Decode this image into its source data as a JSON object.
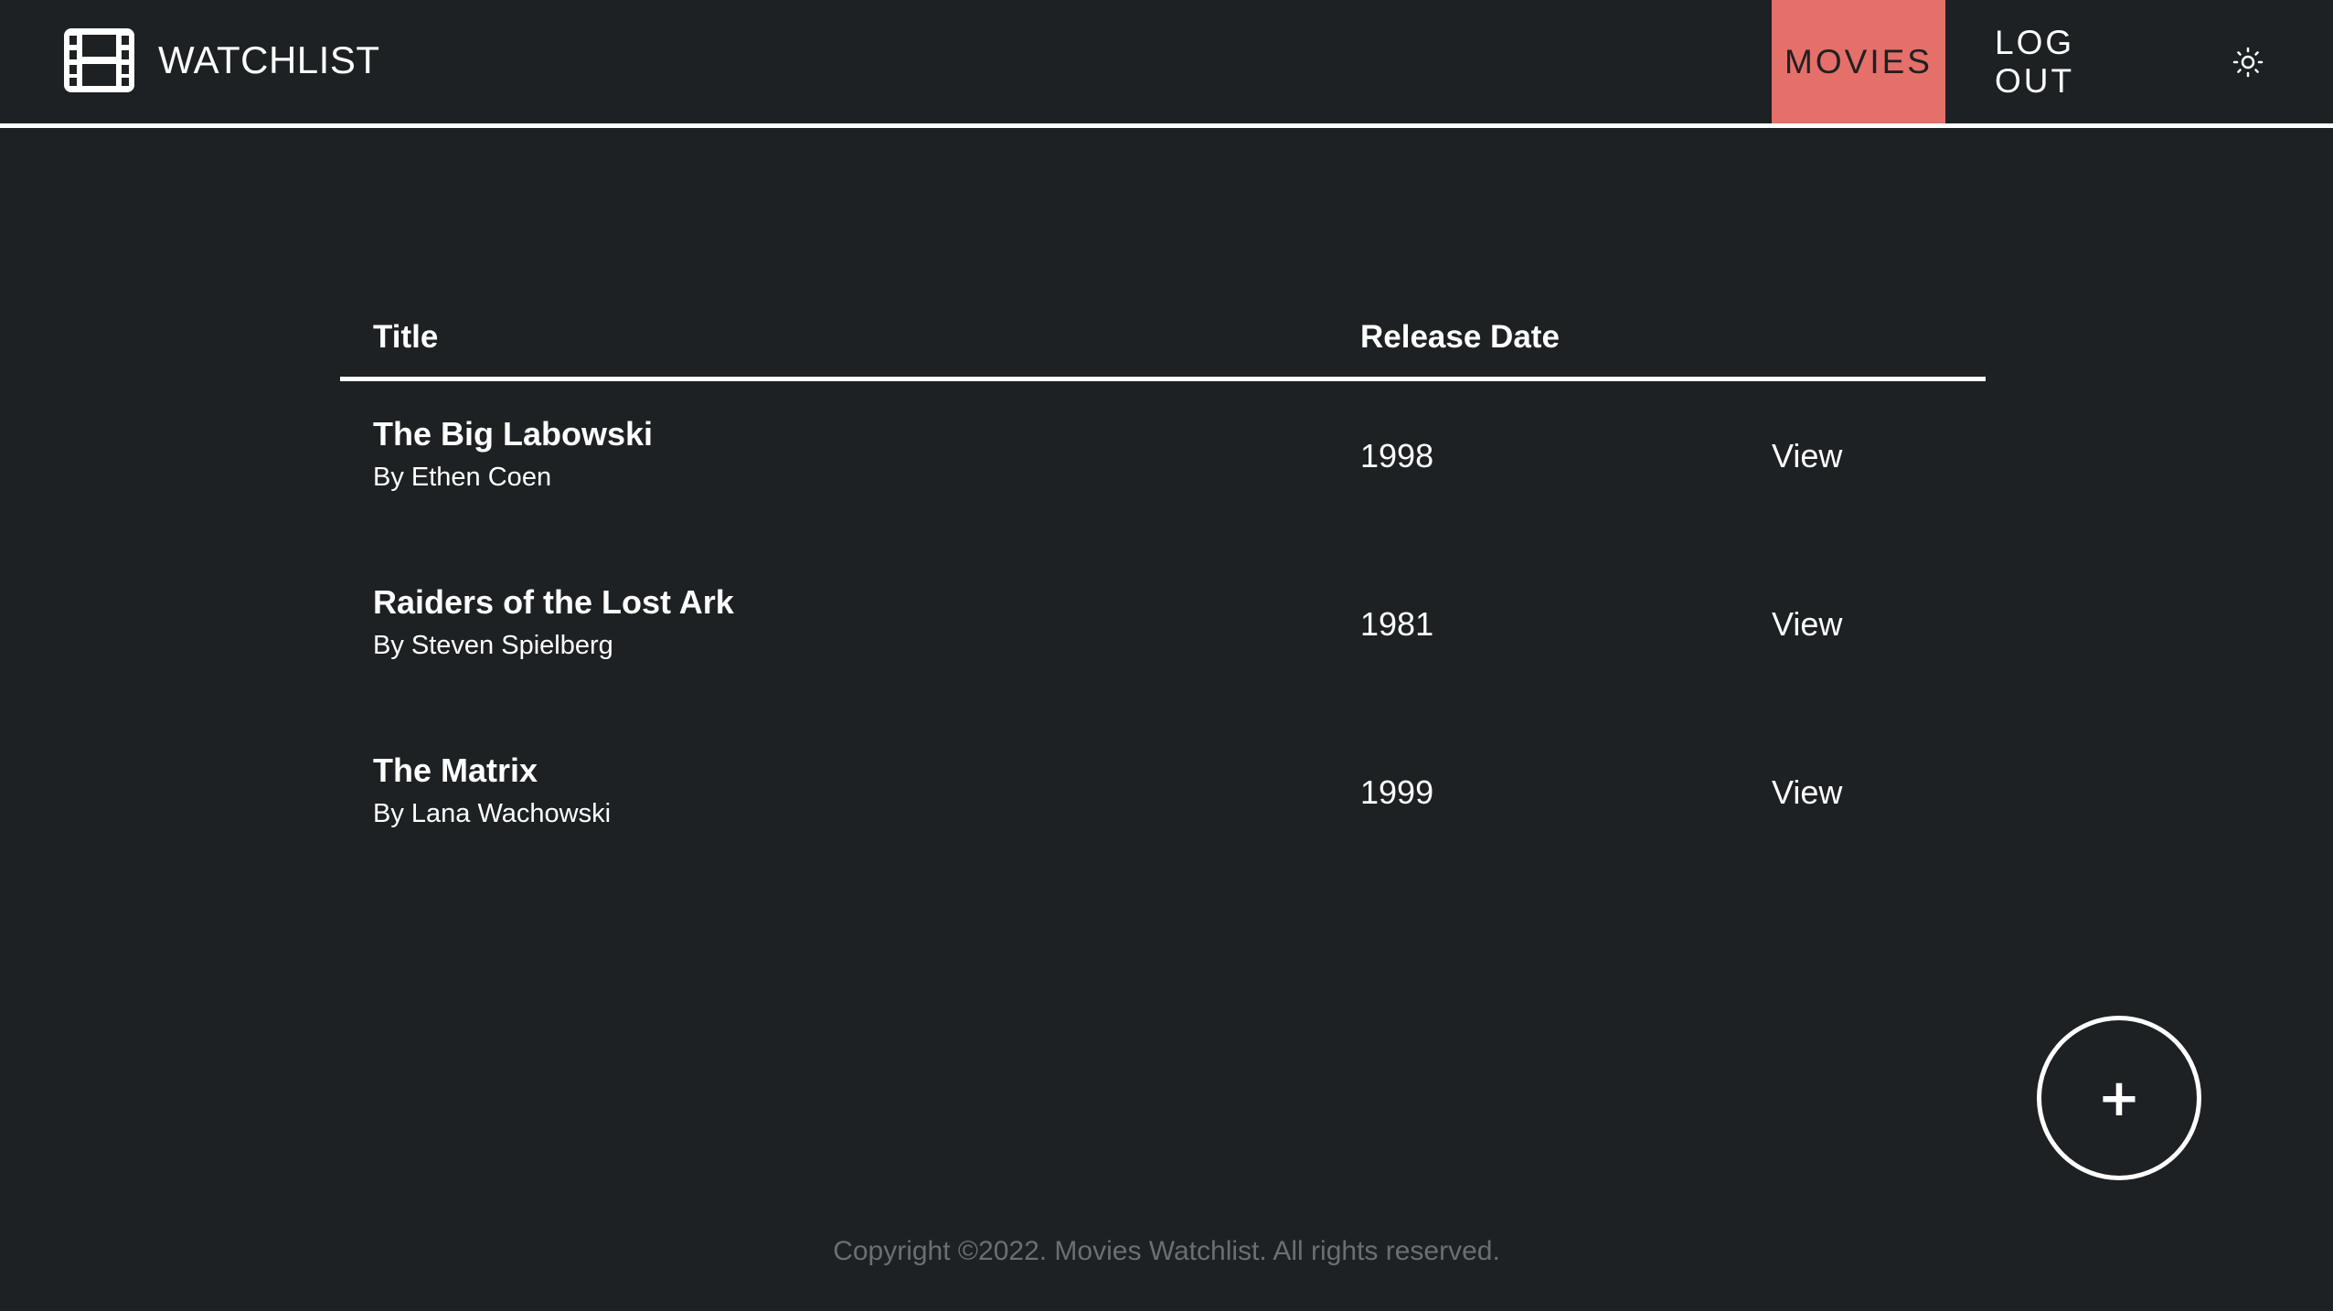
{
  "header": {
    "logo_text": "WATCHLIST",
    "logo_icon": "film-icon",
    "nav": {
      "movies_label": "MOVIES",
      "logout_label": "LOG OUT",
      "theme_icon": "sun-icon"
    }
  },
  "table": {
    "columns": [
      "Title",
      "Release Date"
    ],
    "rows": [
      {
        "title": "The Big Labowski",
        "director": "By Ethen Coen",
        "year": "1998",
        "action": "View"
      },
      {
        "title": "Raiders of the Lost Ark",
        "director": "By Steven Spielberg",
        "year": "1981",
        "action": "View"
      },
      {
        "title": "The Matrix",
        "director": "By Lana Wachowski",
        "year": "1999",
        "action": "View"
      }
    ]
  },
  "add_button": {
    "label": "+"
  },
  "footer": {
    "copyright": "Copyright ©2022. Movies Watchlist. All rights reserved."
  },
  "colors": {
    "background": "#1e2124",
    "accent": "#e56f69",
    "text": "#ffffff",
    "footer_text": "#6b6e72"
  }
}
